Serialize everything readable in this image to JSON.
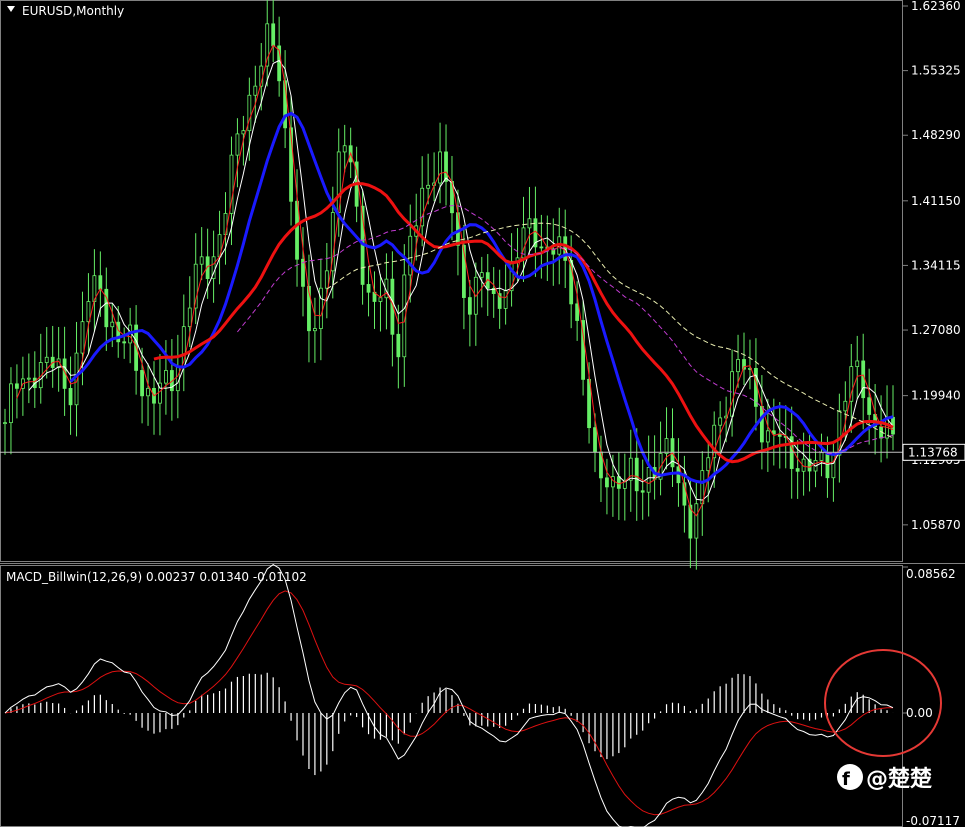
{
  "chart_data": [
    {
      "type": "candlestick",
      "title": "EURUSD,Monthly",
      "ylim": [
        1.0237,
        1.6236
      ],
      "yticks": [
        "1.62360",
        "1.55325",
        "1.48290",
        "1.41150",
        "1.34115",
        "1.27080",
        "1.19940",
        "1.12905",
        "1.05870"
      ],
      "current_price": "1.13768",
      "close_profile": [
        1.17,
        1.2,
        1.22,
        1.24,
        1.22,
        1.23,
        1.21,
        1.25,
        1.3,
        1.33,
        1.28,
        1.24,
        1.26,
        1.22,
        1.19,
        1.2,
        1.23,
        1.28,
        1.32,
        1.34,
        1.37,
        1.41,
        1.47,
        1.53,
        1.56,
        1.58,
        1.55,
        1.44,
        1.3,
        1.25,
        1.33,
        1.4,
        1.47,
        1.44,
        1.33,
        1.28,
        1.32,
        1.25,
        1.35,
        1.38,
        1.44,
        1.47,
        1.41,
        1.33,
        1.31,
        1.34,
        1.28,
        1.32,
        1.35,
        1.36,
        1.38,
        1.37,
        1.36,
        1.33,
        1.3,
        1.2,
        1.09,
        1.11,
        1.12,
        1.11,
        1.08,
        1.13,
        1.14,
        1.12,
        1.09,
        1.07,
        1.1,
        1.15,
        1.2,
        1.23,
        1.22,
        1.2,
        1.16,
        1.15,
        1.13,
        1.14,
        1.12,
        1.11,
        1.13,
        1.19,
        1.21,
        1.22,
        1.18,
        1.16,
        1.14
      ],
      "series": [
        {
          "name": "fast MA",
          "color": "#ffffff"
        },
        {
          "name": "MA",
          "color": "#ff2020"
        },
        {
          "name": "MA",
          "color": "#1a1aff"
        },
        {
          "name": "MA",
          "color": "#ee1111"
        },
        {
          "name": "MA",
          "color": "#c03bd0"
        },
        {
          "name": "MA",
          "color": "#e9edb0"
        }
      ]
    },
    {
      "type": "line",
      "title": "MACD_Billwin(12,26,9) 0.00237 0.01340 -0.01102",
      "ylim": [
        -0.07117,
        0.08562
      ],
      "yticks": [
        "0.08562",
        "0.00",
        "-0.07117"
      ],
      "series": [
        {
          "name": "MACD",
          "color": "#ffffff"
        },
        {
          "name": "Signal",
          "color": "#dd1111"
        },
        {
          "name": "Histogram",
          "color": "#ffffff"
        }
      ]
    }
  ],
  "watermark": "@楚楚"
}
